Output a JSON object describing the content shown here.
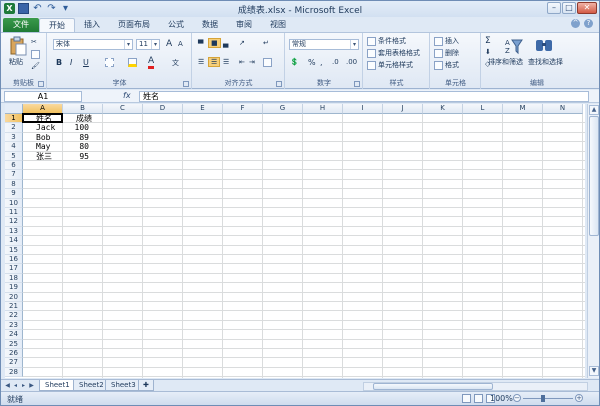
{
  "window": {
    "title": "成绩表.xlsx - Microsoft Excel",
    "app_badge": "X"
  },
  "tabs": [
    "文件",
    "开始",
    "插入",
    "页面布局",
    "公式",
    "数据",
    "审阅",
    "视图"
  ],
  "ribbon": {
    "clipboard": {
      "paste": "粘贴",
      "label": "剪贴板"
    },
    "font": {
      "name": "宋体",
      "size": "11",
      "grow": "A",
      "shrink": "A",
      "bold": "B",
      "italic": "I",
      "underline": "U",
      "label": "字体"
    },
    "alignment": {
      "label": "对齐方式"
    },
    "number": {
      "format": "常规",
      "percent": "%",
      "comma": ",",
      "label": "数字"
    },
    "styles": {
      "conditional": "条件格式",
      "table": "套用表格格式",
      "cell": "单元格样式",
      "label": "样式"
    },
    "cells": {
      "insert": "插入",
      "delete": "删除",
      "format": "格式",
      "label": "单元格"
    },
    "editing": {
      "sum": "Σ",
      "sort": "排序和筛选",
      "find": "查找和选择",
      "label": "编辑"
    }
  },
  "formula_bar": {
    "name_box": "A1",
    "fx": "fx",
    "content": "姓名"
  },
  "columns": [
    "A",
    "B",
    "C",
    "D",
    "E",
    "F",
    "G",
    "H",
    "I",
    "J",
    "K",
    "L",
    "M",
    "N"
  ],
  "rows": [
    "1",
    "2",
    "3",
    "4",
    "5",
    "6",
    "7",
    "8",
    "9",
    "10",
    "11",
    "12",
    "13",
    "14",
    "15",
    "16",
    "17",
    "18",
    "19",
    "20",
    "21",
    "22",
    "23",
    "24",
    "25",
    "26",
    "27",
    "28"
  ],
  "cells": {
    "A1": "姓名",
    "B1": "成绩",
    "A2": "Jack",
    "B2": "100",
    "A3": "Bob",
    "B3": "89",
    "A4": "May",
    "B4": "80",
    "A5": "张三",
    "B5": "95"
  },
  "sheets": [
    "Sheet1",
    "Sheet2",
    "Sheet3"
  ],
  "status": {
    "ready": "就绪",
    "zoom": "100%",
    "minus": "−",
    "plus": "+"
  }
}
